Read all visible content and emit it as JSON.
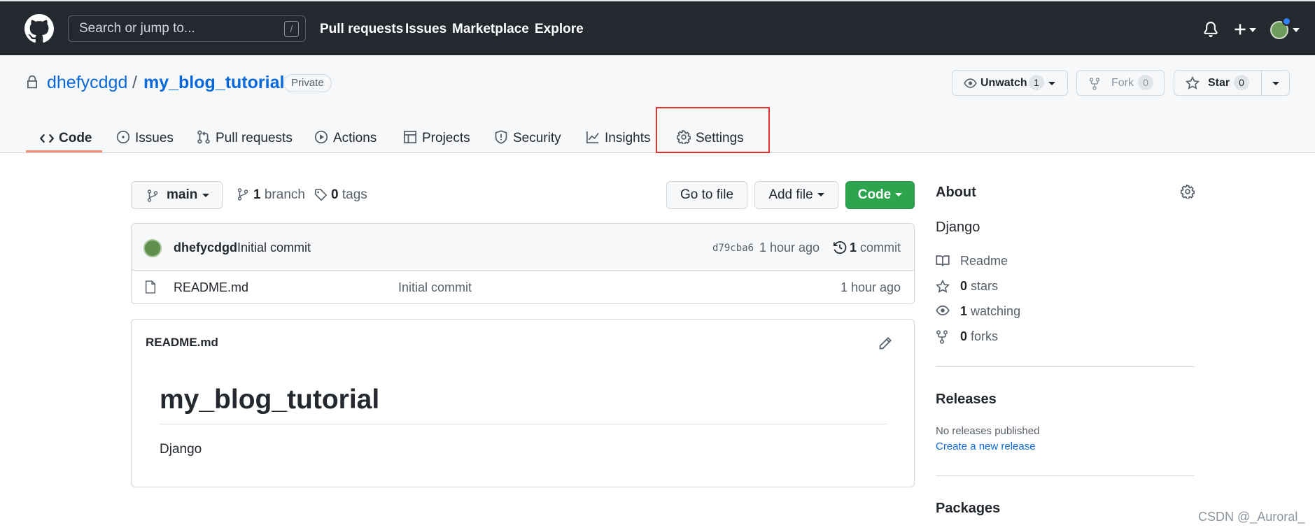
{
  "header": {
    "search_placeholder": "Search or jump to...",
    "search_shortcut": "/",
    "nav": [
      "Pull requests",
      "Issues",
      "Marketplace",
      "Explore"
    ]
  },
  "repo": {
    "owner": "dhefycdgd",
    "separator": "/",
    "name": "my_blog_tutorial",
    "visibility": "Private",
    "unwatch_label": "Unwatch",
    "watch_count": "1",
    "fork_label": "Fork",
    "fork_count": "0",
    "star_label": "Star",
    "star_count": "0"
  },
  "tabs": [
    {
      "label": "Code",
      "icon": "code-icon",
      "active": true
    },
    {
      "label": "Issues",
      "icon": "issue-icon"
    },
    {
      "label": "Pull requests",
      "icon": "pull-request-icon"
    },
    {
      "label": "Actions",
      "icon": "play-icon"
    },
    {
      "label": "Projects",
      "icon": "table-icon"
    },
    {
      "label": "Security",
      "icon": "shield-icon"
    },
    {
      "label": "Insights",
      "icon": "graph-icon"
    },
    {
      "label": "Settings",
      "icon": "gear-icon",
      "highlighted": true
    }
  ],
  "toolbar": {
    "branch": "main",
    "branch_count": "1",
    "branch_label": "branch",
    "tag_count": "0",
    "tag_label": "tags",
    "go_to_file": "Go to file",
    "add_file": "Add file",
    "code": "Code"
  },
  "commit": {
    "author": "dhefycdgd",
    "message": "Initial commit",
    "hash": "d79cba6",
    "time": "1 hour ago",
    "count": "1",
    "count_label": "commit"
  },
  "files": [
    {
      "name": "README.md",
      "message": "Initial commit",
      "time": "1 hour ago"
    }
  ],
  "readme": {
    "filename": "README.md",
    "heading": "my_blog_tutorial",
    "body": "Django"
  },
  "about": {
    "title": "About",
    "description": "Django",
    "readme": "Readme",
    "stars_count": "0",
    "stars_label": "stars",
    "watching_count": "1",
    "watching_label": "watching",
    "forks_count": "0",
    "forks_label": "forks"
  },
  "releases": {
    "title": "Releases",
    "none": "No releases published",
    "create": "Create a new release"
  },
  "packages": {
    "title": "Packages"
  },
  "watermark": "CSDN @_Auroral_",
  "colors": {
    "header_bg": "#24292f",
    "link": "#0969da",
    "green": "#2da44e",
    "tab_underline": "#fd8c73",
    "highlight_box": "#e5322d"
  }
}
